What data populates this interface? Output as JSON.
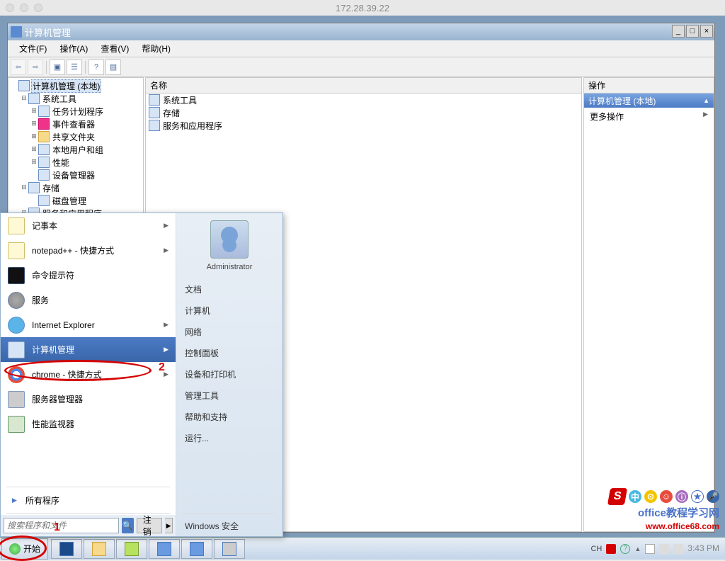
{
  "mac": {
    "title": "172.28.39.22"
  },
  "mgmt": {
    "title": "计算机管理",
    "menus": [
      "文件(F)",
      "操作(A)",
      "查看(V)",
      "帮助(H)"
    ],
    "tree": {
      "root": "计算机管理 (本地)",
      "sys_tools": "系统工具",
      "task_sched": "任务计划程序",
      "event_viewer": "事件查看器",
      "shared": "共享文件夹",
      "users": "本地用户和组",
      "perf": "性能",
      "devmgr": "设备管理器",
      "storage": "存储",
      "diskmgr": "磁盘管理",
      "services_apps": "服务和应用程序"
    },
    "mid_header": "名称",
    "mid_rows": [
      "系统工具",
      "存储",
      "服务和应用程序"
    ],
    "right_header": "操作",
    "right_strip": "计算机管理 (本地)",
    "right_more": "更多操作"
  },
  "start": {
    "left": {
      "notepad": "记事本",
      "notepadpp": "notepad++ - 快捷方式",
      "cmd": "命令提示符",
      "services": "服务",
      "ie": "Internet Explorer",
      "compmgmt": "计算机管理",
      "chrome": "chrome - 快捷方式",
      "servermgr": "服务器管理器",
      "perfmon": "性能监视器",
      "all_programs": "所有程序",
      "search_ph": "搜索程序和文件",
      "logout": "注销"
    },
    "right": {
      "user": "Administrator",
      "items": [
        "文档",
        "计算机",
        "网络",
        "控制面板",
        "设备和打印机",
        "管理工具",
        "帮助和支持",
        "运行...",
        "Windows 安全"
      ]
    }
  },
  "annotations": {
    "n1": "1",
    "n2": "2"
  },
  "taskbar": {
    "start": "开始",
    "tray_lang": "CH",
    "tray_time": "3:43 PM"
  },
  "watermark": {
    "chars": [
      "中",
      "⊙",
      "☺",
      "ⓘ",
      "★",
      "🎤"
    ],
    "text": "office教程学习网",
    "url": "www.office68.com"
  }
}
